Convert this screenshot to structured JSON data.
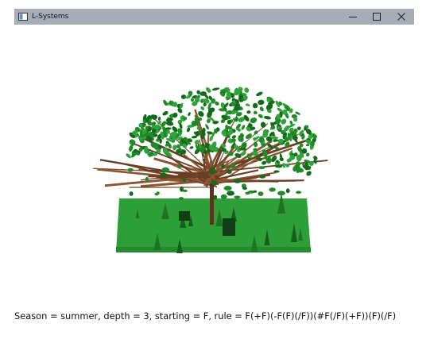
{
  "window": {
    "title": "L-Systems",
    "icon": "app-window-icon",
    "controls": {
      "minimize": "minimize-icon",
      "maximize": "maximize-icon",
      "close": "close-icon"
    }
  },
  "scene": {
    "description_icon": "3d-tree-render",
    "ground_color": "#2e9e38",
    "leaf_color": "#1f8a27",
    "trunk_color": "#5a3420"
  },
  "status": {
    "text": "Season = summer, depth = 3, starting = F, rule = F(+F)(-F(F)(/F))(#F(/F)(+F))(F)(/F)"
  }
}
